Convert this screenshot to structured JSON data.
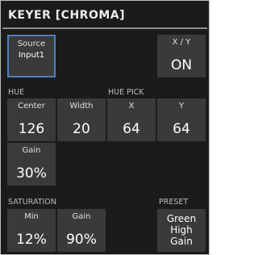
{
  "title": "KEYER [CHROMA]",
  "source": {
    "label": "Source",
    "value": "Input1"
  },
  "xy": {
    "label": "X / Y",
    "value": "ON"
  },
  "sections": {
    "hue": "HUE",
    "hue_pick": "HUE PICK",
    "saturation": "SATURATION",
    "preset": "PRESET"
  },
  "hue": {
    "center": {
      "label": "Center",
      "value": "126"
    },
    "width": {
      "label": "Width",
      "value": "20"
    },
    "gain": {
      "label": "Gain",
      "value": "30%"
    }
  },
  "hue_pick": {
    "x": {
      "label": "X",
      "value": "64"
    },
    "y": {
      "label": "Y",
      "value": "64"
    }
  },
  "saturation": {
    "min": {
      "label": "Min",
      "value": "12%"
    },
    "gain": {
      "label": "Gain",
      "value": "90%"
    }
  },
  "preset": {
    "line1": "Green",
    "line2": "High Gain"
  },
  "colors": {
    "background": "#1b1b1b",
    "tile": "#3a3a3a",
    "selection": "#4f80c0"
  }
}
